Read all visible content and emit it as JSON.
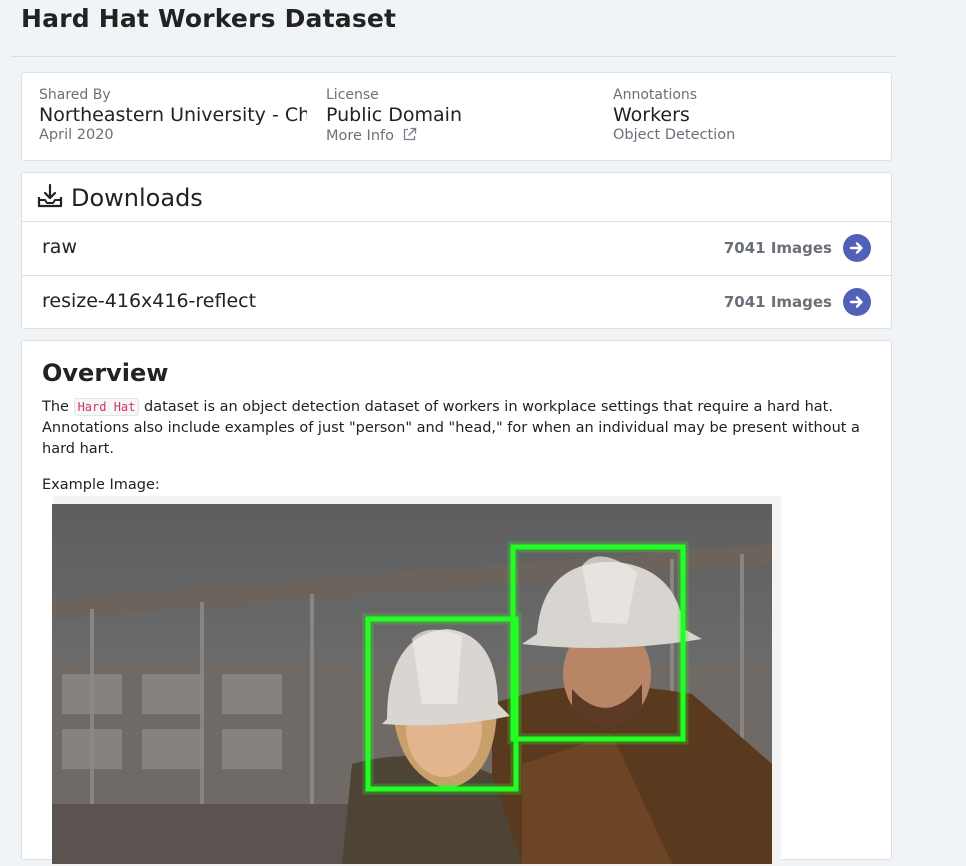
{
  "page": {
    "title": "Hard Hat Workers Dataset"
  },
  "info": {
    "shared_by": {
      "label": "Shared By",
      "value": "Northeastern University - Ch",
      "sub": "April 2020"
    },
    "license": {
      "label": "License",
      "value": "Public Domain",
      "link": "More Info"
    },
    "annotations": {
      "label": "Annotations",
      "value": "Workers",
      "sub": "Object Detection"
    }
  },
  "downloads": {
    "title": "Downloads",
    "items": [
      {
        "name": "raw",
        "count": "7041 Images"
      },
      {
        "name": "resize-416x416-reflect",
        "count": "7041 Images"
      }
    ]
  },
  "overview": {
    "title": "Overview",
    "text_pre": "The",
    "code": "Hard Hat",
    "text_post": "dataset is an object detection dataset of workers in workplace settings that require a hard hat. Annotations also include examples of just \"person\" and \"head,\" for when an individual may be present without a hard hart.",
    "example_label": "Example Image:"
  },
  "colors": {
    "accent": "#5161b7",
    "bbox": "#22ff22",
    "code_text": "#d6336c"
  },
  "icons": {
    "downloads": "download-tray-icon",
    "external": "external-link-icon",
    "arrow": "arrow-right-circle-icon"
  }
}
